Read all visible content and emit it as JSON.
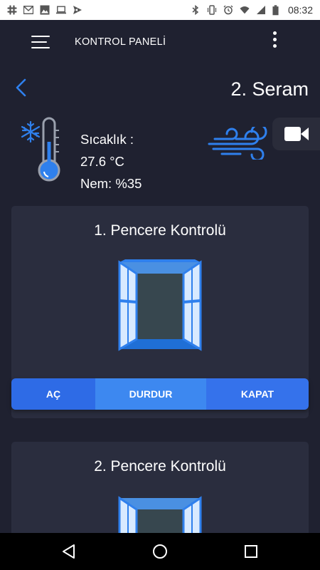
{
  "status_bar": {
    "time": "08:32",
    "left_icons": [
      "slack-icon",
      "gmail-icon",
      "gallery-icon",
      "laptop-icon",
      "send-icon"
    ],
    "right_icons": [
      "bluetooth-icon",
      "vibrate-icon",
      "alarm-icon",
      "wifi-icon",
      "signal-icon",
      "battery-icon"
    ]
  },
  "app_bar": {
    "title": "KONTROL PANELİ",
    "menu_icon": "hamburger-menu-icon",
    "more_icon": "more-vertical-icon"
  },
  "header": {
    "back_icon": "chevron-left-icon",
    "title": "2. Seram"
  },
  "sensor": {
    "temperature_label": "Sıcaklık :",
    "temperature_value": "27.6 °C",
    "humidity": "Nem: %35",
    "thermometer_icon": "thermometer-snowflake-icon",
    "wind_icon": "wind-icon",
    "camera_icon": "video-camera-icon"
  },
  "windows": [
    {
      "title": "1. Pencere Kontrolü",
      "icon": "open-window-icon",
      "buttons": {
        "open": "AÇ",
        "stop": "DURDUR",
        "close": "KAPAT"
      }
    },
    {
      "title": "2. Pencere Kontrolü",
      "icon": "open-window-icon"
    }
  ],
  "nav_bar": {
    "back_icon": "nav-back-icon",
    "home_icon": "nav-home-icon",
    "recents_icon": "nav-recents-icon"
  },
  "colors": {
    "background": "#1f2130",
    "card": "#2a2d3e",
    "accent": "#3d88f0",
    "icon_blue": "#2f80ed"
  }
}
